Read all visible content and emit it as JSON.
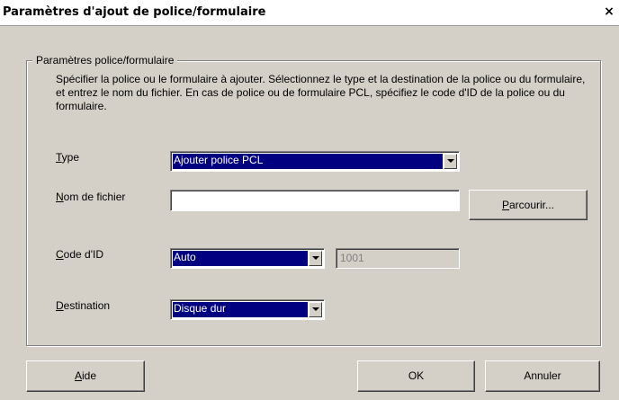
{
  "window": {
    "title": "Paramètres d'ajout de police/formulaire",
    "close_glyph": "×"
  },
  "group": {
    "legend": "Paramètres police/formulaire",
    "description": "Spécifier la police ou le formulaire à ajouter. Sélectionnez le type et la destination de la police ou du formulaire, et entrez le nom du fichier. En cas de police ou de formulaire PCL, spécifiez le code d'ID de la police ou du formulaire."
  },
  "fields": {
    "type": {
      "mnemonic": "T",
      "label_rest": "ype",
      "value": "Ajouter police PCL"
    },
    "filename": {
      "mnemonic": "N",
      "label_rest": "om de fichier",
      "value": ""
    },
    "browse_button": {
      "mnemonic": "P",
      "label_rest": "arcourir..."
    },
    "id_code": {
      "mnemonic": "C",
      "label_rest": "ode d'ID",
      "value": "Auto",
      "id_value": "1001"
    },
    "destination": {
      "mnemonic": "D",
      "label_rest": "estination",
      "value": "Disque dur"
    }
  },
  "buttons": {
    "help": {
      "mnemonic": "A",
      "label_rest": "ide"
    },
    "ok": {
      "label": "OK"
    },
    "cancel": {
      "label": "Annuler"
    }
  }
}
